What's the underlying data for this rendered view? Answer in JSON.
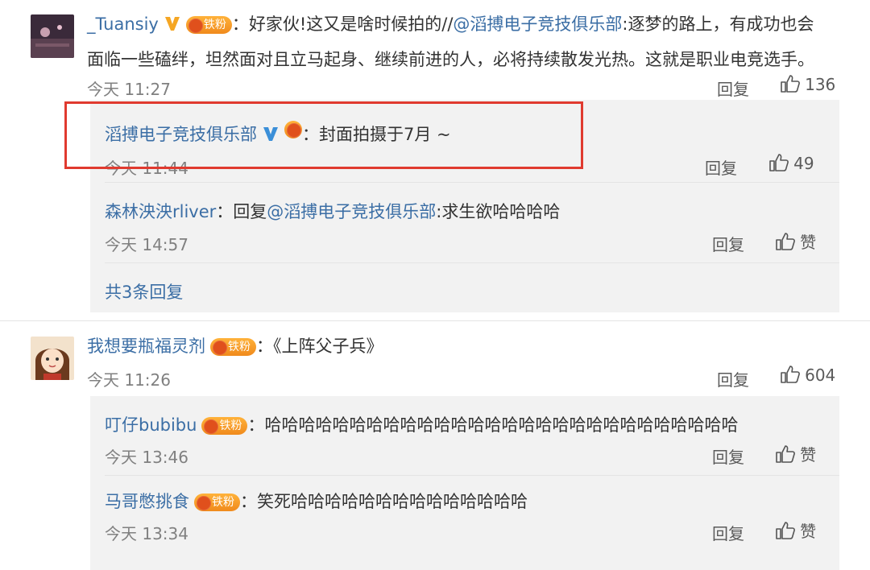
{
  "comments": [
    {
      "user": "_Tuansiy",
      "text_pre": "：好家伙!这又是啥时候拍的//",
      "mention": "@滔搏电子竞技俱乐部",
      "text_line1_post": ":逐梦的路上，有成功也会",
      "text_line2": "面临一些磕绊，坦然面对且立马起身、继续前进的人，必将持续散发光热。这就是职业电竞选手。",
      "time": "今天 11:27",
      "reply": "回复",
      "likes": "136",
      "badge": "铁粉"
    },
    {
      "user": "我想要瓶福灵剂",
      "badge": "铁粉",
      "text": "：《上阵父子兵》",
      "time": "今天 11:26",
      "reply": "回复",
      "likes": "604"
    }
  ],
  "replies1": [
    {
      "user": "滔搏电子竞技俱乐部",
      "text": "：封面拍摄于7月 ~",
      "time": "今天 11:44",
      "reply": "回复",
      "likes": "49"
    },
    {
      "user": "森林泱泱rliver",
      "text_pre": "：回复",
      "mention": "@滔搏电子竞技俱乐部",
      "text_post": ":求生欲哈哈哈哈",
      "time": "今天 14:57",
      "reply": "回复",
      "likes": "赞"
    }
  ],
  "replies1_more": "共3条回复",
  "replies2": [
    {
      "user": "叮仔bubibu",
      "badge": "铁粉",
      "text": "：哈哈哈哈哈哈哈哈哈哈哈哈哈哈哈哈哈哈哈哈哈哈哈哈哈哈哈哈",
      "time": "今天 13:46",
      "reply": "回复",
      "likes": "赞"
    },
    {
      "user": "马哥憋挑食",
      "badge": "铁粉",
      "text": "：笑死哈哈哈哈哈哈哈哈哈哈哈哈哈哈",
      "time": "今天 13:34",
      "reply": "回复",
      "likes": "赞"
    }
  ],
  "colors": {
    "link": "#3b6ea5",
    "highlight_box": "#e03a2f",
    "badge": "#f08a1c"
  }
}
